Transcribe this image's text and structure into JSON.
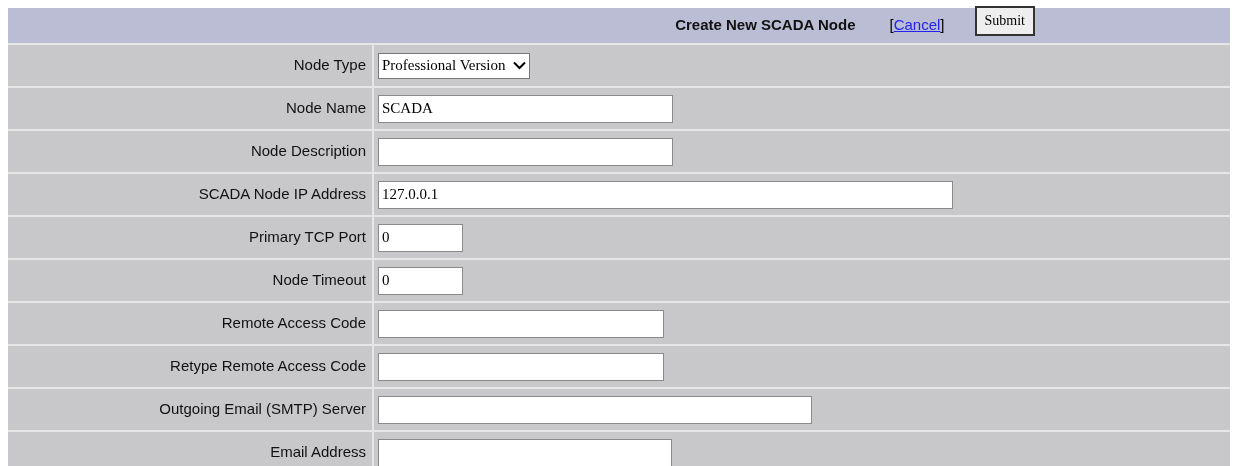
{
  "header": {
    "title": "Create New SCADA Node",
    "cancel_link": "Cancel",
    "cancel_brackets": [
      "[",
      "]"
    ],
    "submit_button": "Submit"
  },
  "rows": [
    {
      "kind": "select",
      "label": "Node Type",
      "value": "Professional Version"
    },
    {
      "kind": "text",
      "label": "Node Name",
      "value": "SCADA"
    },
    {
      "kind": "text",
      "label": "Node Description"
    },
    {
      "kind": "text",
      "label": "SCADA Node IP Address",
      "value": "127.0.0.1"
    },
    {
      "kind": "text",
      "label": "Primary TCP Port",
      "value": "0"
    },
    {
      "kind": "text",
      "label": "Node Timeout",
      "value": "0"
    },
    {
      "kind": "text",
      "label": "Remote Access Code"
    },
    {
      "kind": "text",
      "label": "Retype Remote Access Code"
    },
    {
      "kind": "text",
      "label": "Outgoing Email (SMTP) Server"
    },
    {
      "kind": "text",
      "label": "Email Address"
    }
  ]
}
